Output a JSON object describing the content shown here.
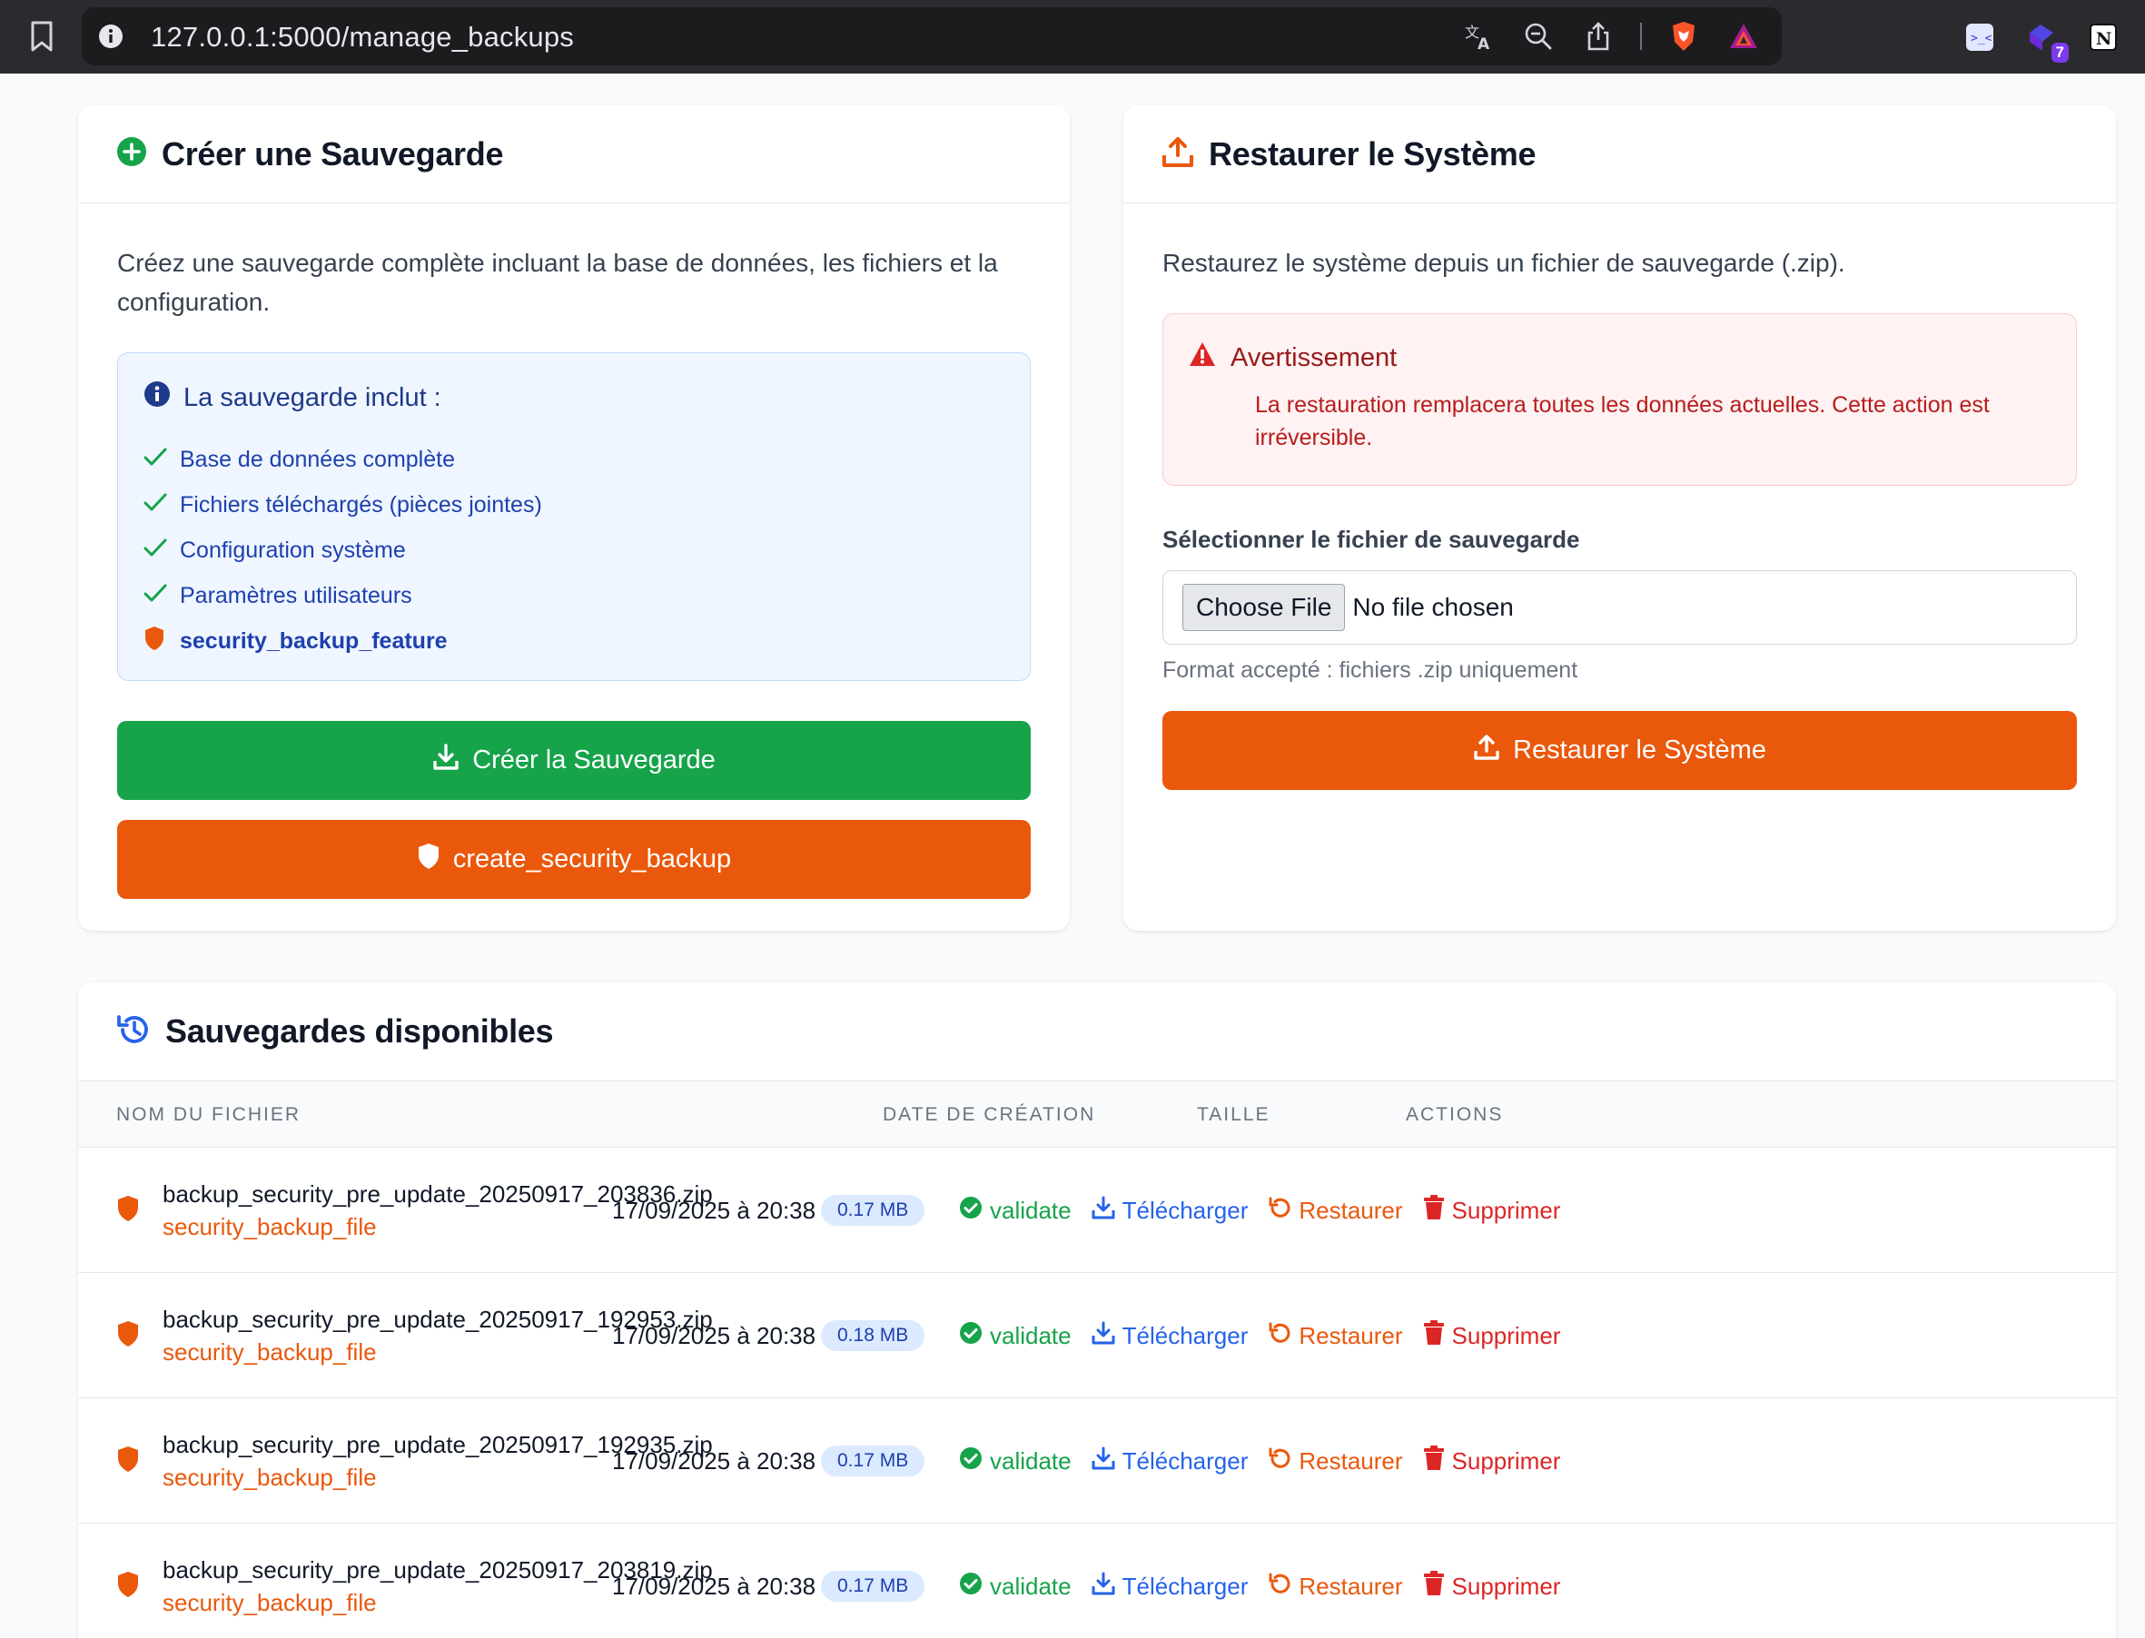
{
  "browser": {
    "url": "127.0.0.1:5000/manage_backups",
    "extension_badge": "7"
  },
  "create_card": {
    "title": "Créer une Sauvegarde",
    "description": "Créez une sauvegarde complète incluant la base de données, les fichiers et la configuration.",
    "info_title": "La sauvegarde inclut :",
    "items": [
      "Base de données complète",
      "Fichiers téléchargés (pièces jointes)",
      "Configuration système",
      "Paramètres utilisateurs"
    ],
    "feature_item": "security_backup_feature",
    "create_button": "Créer la Sauvegarde",
    "security_button": "create_security_backup",
    "colors": {
      "green": "#16a34a",
      "orange": "#ea580c"
    }
  },
  "restore_card": {
    "title": "Restaurer le Système",
    "description": "Restaurez le système depuis un fichier de sauvegarde (.zip).",
    "warning_title": "Avertissement",
    "warning_text": "La restauration remplacera toutes les données actuelles. Cette action est irréversible.",
    "file_label": "Sélectionner le fichier de sauvegarde",
    "choose_file": "Choose File",
    "no_file": "No file chosen",
    "hint": "Format accepté : fichiers .zip uniquement",
    "restore_button": "Restaurer le Système"
  },
  "backups": {
    "title": "Sauvegardes disponibles",
    "columns": [
      "NOM DU FICHIER",
      "DATE DE CRÉATION",
      "TAILLE",
      "ACTIONS"
    ],
    "action_labels": {
      "validate": "validate",
      "download": "Télécharger",
      "restore": "Restaurer",
      "delete": "Supprimer"
    },
    "rows": [
      {
        "name": "backup_security_pre_update_20250917_203836.zip",
        "tag": "security_backup_file",
        "date": "17/09/2025 à 20:38",
        "size": "0.17 MB"
      },
      {
        "name": "backup_security_pre_update_20250917_192953.zip",
        "tag": "security_backup_file",
        "date": "17/09/2025 à 20:38",
        "size": "0.18 MB"
      },
      {
        "name": "backup_security_pre_update_20250917_192935.zip",
        "tag": "security_backup_file",
        "date": "17/09/2025 à 20:38",
        "size": "0.17 MB"
      },
      {
        "name": "backup_security_pre_update_20250917_203819.zip",
        "tag": "security_backup_file",
        "date": "17/09/2025 à 20:38",
        "size": "0.17 MB"
      }
    ]
  }
}
